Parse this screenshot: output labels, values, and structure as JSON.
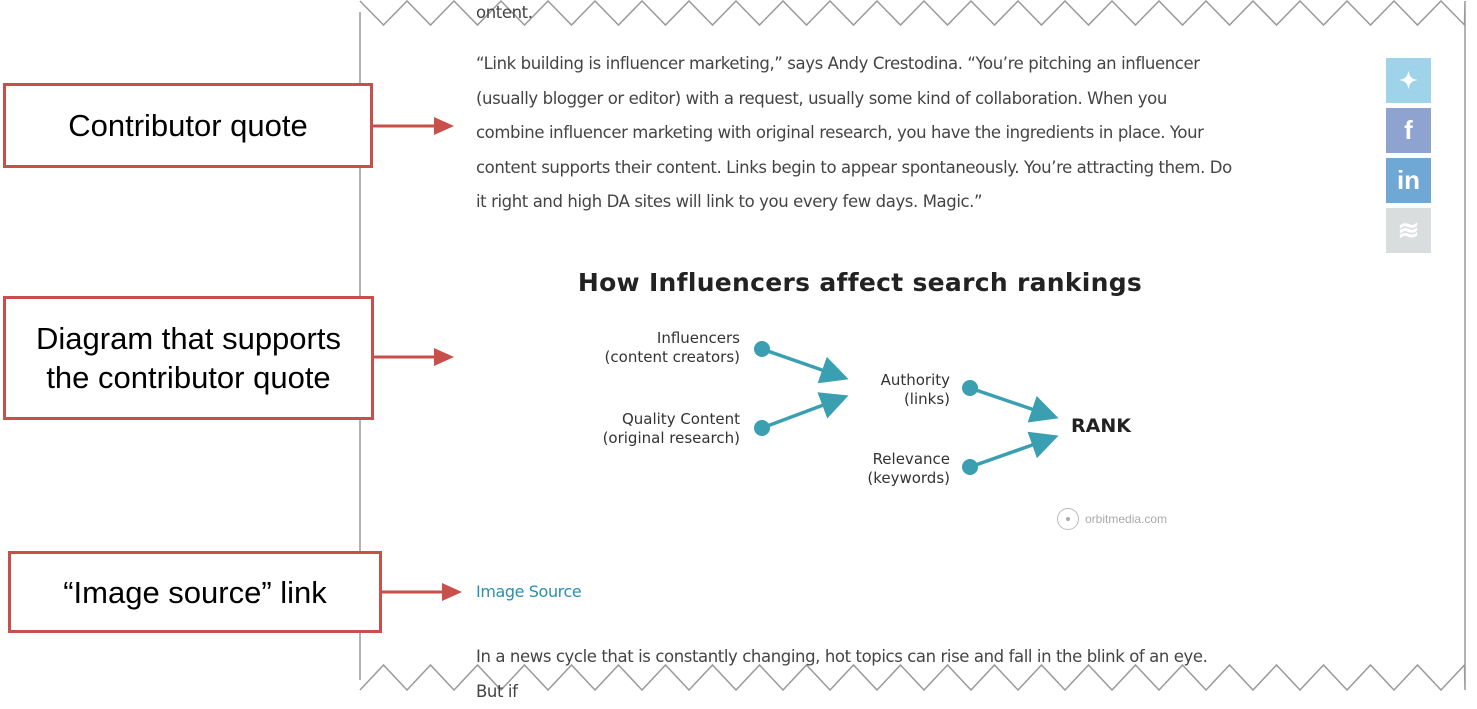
{
  "callouts": [
    {
      "label": "Contributor quote"
    },
    {
      "label": "Diagram that supports the contributor quote"
    },
    {
      "label": "“Image source” link"
    }
  ],
  "article": {
    "cut_top_text": "ontent.",
    "quote": "“Link building is influencer marketing,” says Andy Crestodina. “You’re pitching an influencer (usually blogger or editor) with a request, usually some kind of collaboration. When you combine influencer marketing with original research, you have the ingredients in place. Your content supports their content. Links begin to appear spontaneously. You’re attracting them. Do it right and high DA sites will link to you every few days. Magic.”",
    "image_source_link": "Image Source",
    "next_paragraph": "In a news cycle that is constantly changing, hot topics can rise and fall in the blink of an eye. But if"
  },
  "diagram": {
    "title": "How Influencers affect search rankings",
    "nodes": {
      "influencers": "Influencers\n(content creators)",
      "quality": "Quality Content\n(original research)",
      "authority": "Authority\n(links)",
      "relevance": "Relevance\n(keywords)",
      "rank": "RANK"
    },
    "watermark": "orbitmedia.com",
    "accent": "#3a9fb0"
  },
  "social": [
    {
      "name": "twitter",
      "glyph": "🐦",
      "color": "#9ed3ea"
    },
    {
      "name": "facebook",
      "glyph": "f",
      "color": "#8fa3d1"
    },
    {
      "name": "linkedin",
      "glyph": "in",
      "color": "#6fa8d4"
    },
    {
      "name": "buffer",
      "glyph": "≋",
      "color": "#d9dddd"
    }
  ],
  "colors": {
    "callout": "#c9504a",
    "link": "#2a8fb0"
  }
}
